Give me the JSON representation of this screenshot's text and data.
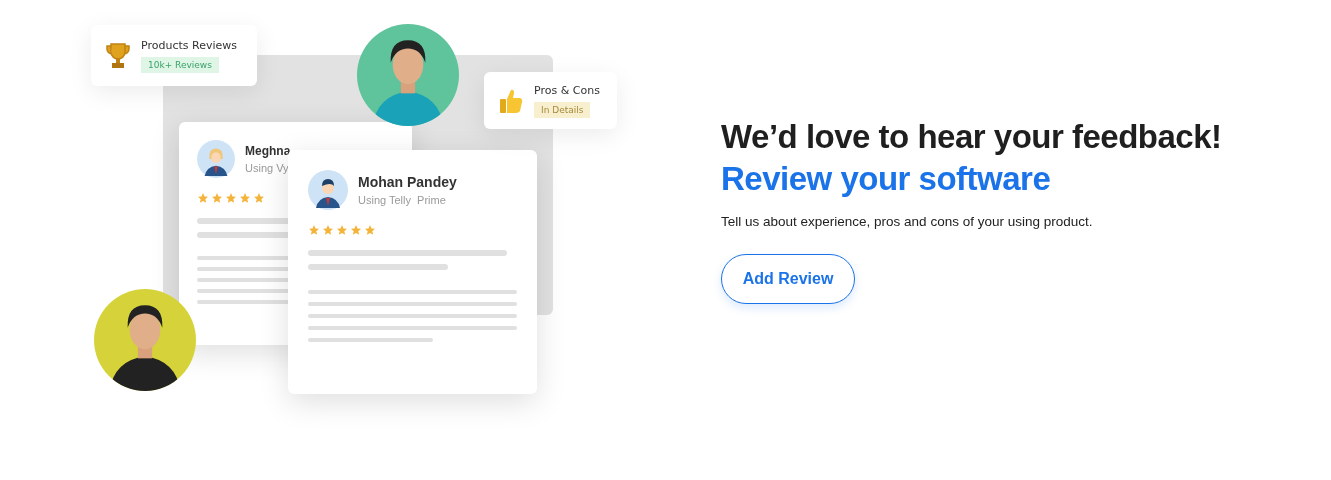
{
  "badges": [
    {
      "kind": "trophy",
      "title": "Products Reviews",
      "tag": "10k+ Reviews",
      "color": "#dff5e6"
    },
    {
      "kind": "thumb",
      "title": "Pros & Cons",
      "tag": "In Details",
      "color": "#f8efcf"
    }
  ],
  "reviews": [
    {
      "name": "Meghna",
      "product": "Using Vy",
      "stars": 5,
      "kind": "woman"
    },
    {
      "name": "Mohan Pandey",
      "product": "Using Telly  Prime",
      "stars": 5,
      "kind": "man"
    }
  ],
  "heading": "We’d love to hear your feedback!",
  "subheading": "Review your software",
  "text": "Tell us about experience, pros and cons of your using product.",
  "button": "Add Review"
}
